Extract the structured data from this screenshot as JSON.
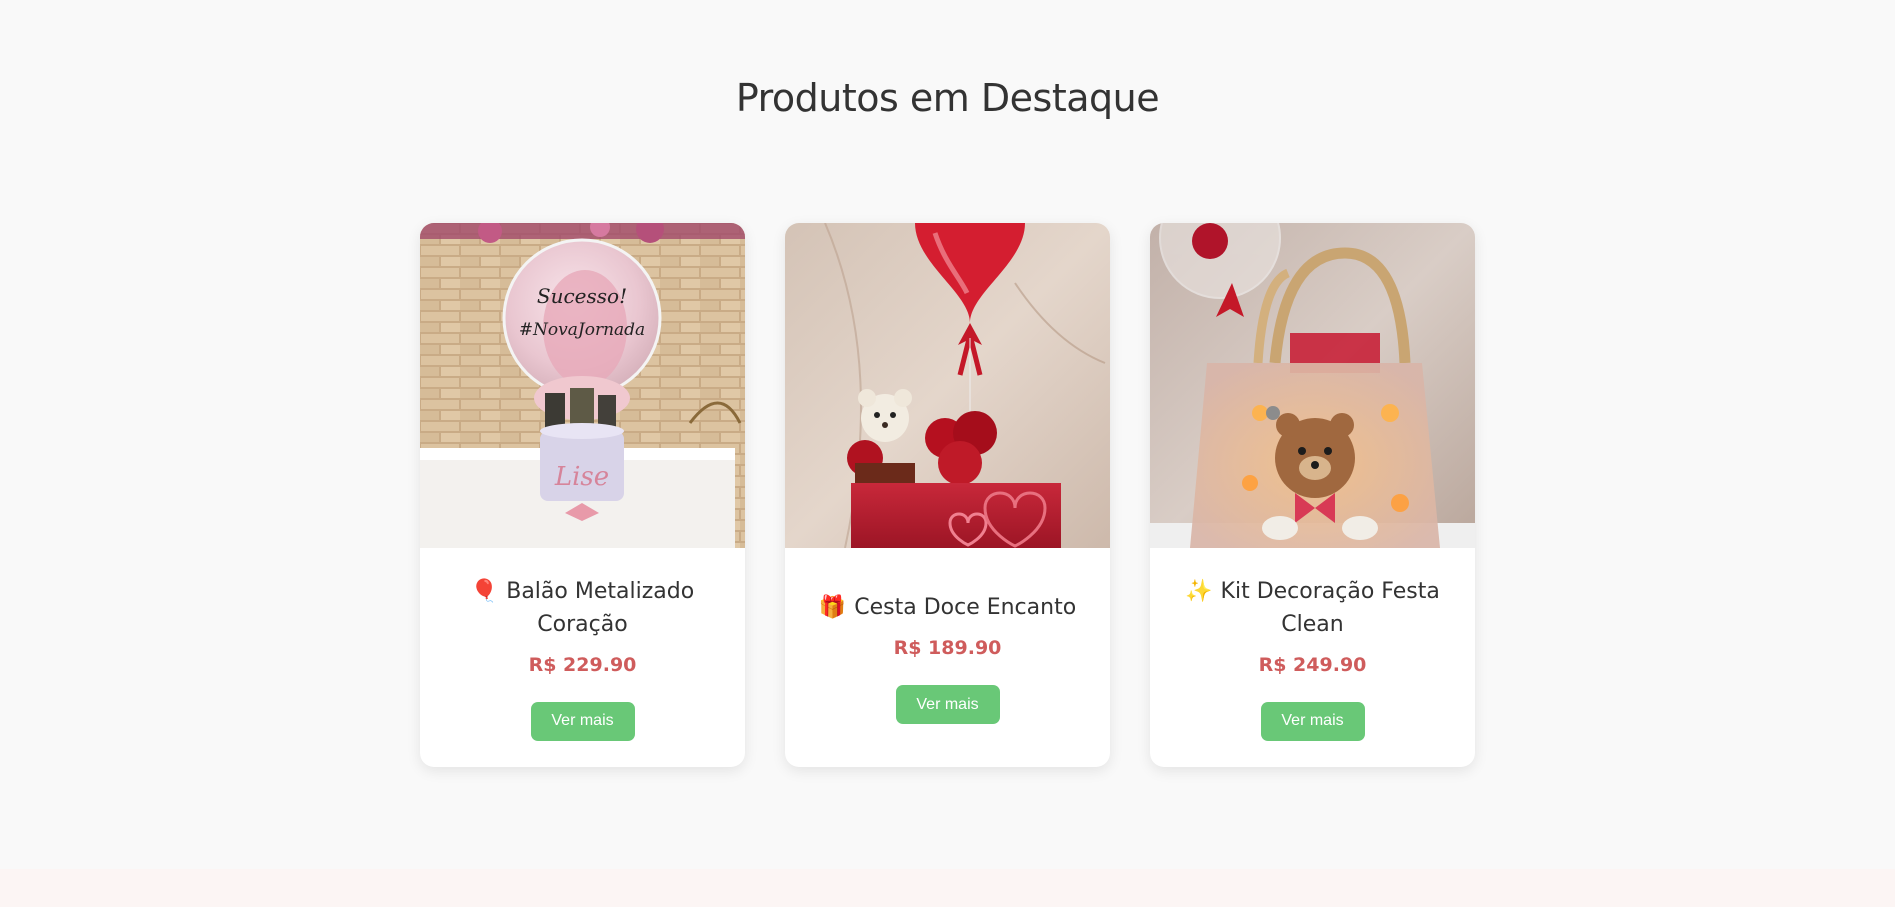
{
  "section": {
    "title": "Produtos em Destaque"
  },
  "products": [
    {
      "emoji": "🎈",
      "name": "Balão Metalizado Coração",
      "price": "R$ 229.90",
      "button_label": "Ver mais",
      "balloon_text": "Sucesso!\n#NovaJornada"
    },
    {
      "emoji": "🎁",
      "name": "Cesta Doce Encanto",
      "price": "R$ 189.90",
      "button_label": "Ver mais"
    },
    {
      "emoji": "✨",
      "name": "Kit Decoração Festa Clean",
      "price": "R$ 249.90",
      "button_label": "Ver mais"
    }
  ],
  "colors": {
    "background": "#f9f9f9",
    "title": "#333333",
    "price": "#cf5c5c",
    "button": "#69c877",
    "button_text": "#ffffff"
  }
}
